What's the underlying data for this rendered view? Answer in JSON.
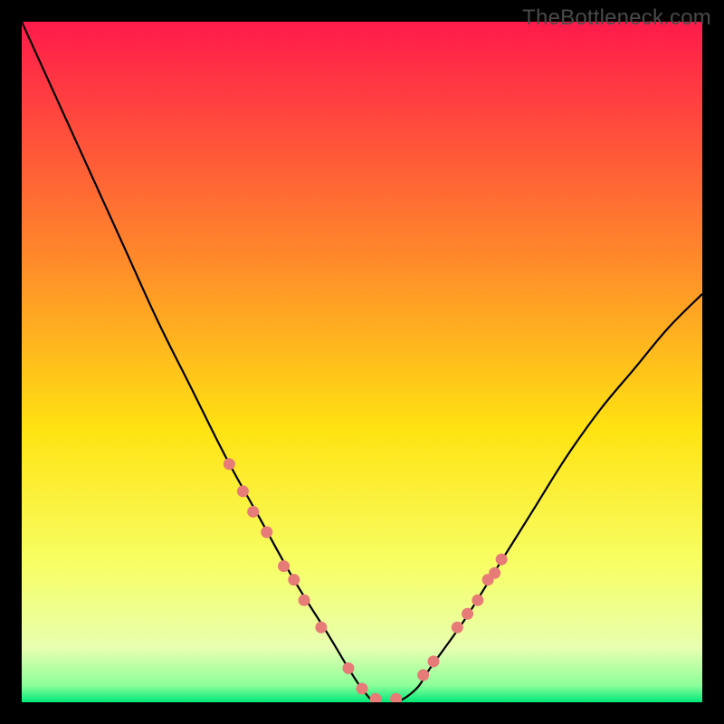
{
  "watermark": "TheBottleneck.com",
  "chart_data": {
    "type": "line",
    "title": "",
    "xlabel": "",
    "ylabel": "",
    "xlim": [
      0,
      100
    ],
    "ylim": [
      0,
      100
    ],
    "background_gradient": {
      "stops": [
        {
          "offset": 0.0,
          "color": "#ff1a4b"
        },
        {
          "offset": 0.35,
          "color": "#ff8a2a"
        },
        {
          "offset": 0.6,
          "color": "#ffe312"
        },
        {
          "offset": 0.8,
          "color": "#f7ff66"
        },
        {
          "offset": 0.92,
          "color": "#e8ffb0"
        },
        {
          "offset": 0.975,
          "color": "#8dff9a"
        },
        {
          "offset": 1.0,
          "color": "#00e87a"
        }
      ]
    },
    "series": [
      {
        "name": "bottleneck-curve",
        "color": "#000000",
        "x": [
          0,
          5,
          10,
          15,
          20,
          25,
          30,
          35,
          40,
          45,
          48,
          50,
          52,
          55,
          58,
          60,
          65,
          70,
          75,
          80,
          85,
          90,
          95,
          100
        ],
        "y": [
          100,
          89,
          78,
          67,
          56,
          46,
          36,
          27,
          18,
          10,
          5,
          2,
          0,
          0,
          2,
          5,
          12,
          20,
          28,
          36,
          43,
          49,
          55,
          60
        ]
      }
    ],
    "markers": {
      "name": "highlighted-points",
      "color": "#e77b78",
      "points": [
        {
          "x": 30.5,
          "y": 35
        },
        {
          "x": 32.5,
          "y": 31
        },
        {
          "x": 34.0,
          "y": 28
        },
        {
          "x": 36.0,
          "y": 25
        },
        {
          "x": 38.5,
          "y": 20
        },
        {
          "x": 40.0,
          "y": 18
        },
        {
          "x": 41.5,
          "y": 15
        },
        {
          "x": 44.0,
          "y": 11
        },
        {
          "x": 48.0,
          "y": 5
        },
        {
          "x": 50.0,
          "y": 2
        },
        {
          "x": 52.0,
          "y": 0.5
        },
        {
          "x": 55.0,
          "y": 0.5
        },
        {
          "x": 59.0,
          "y": 4
        },
        {
          "x": 60.5,
          "y": 6
        },
        {
          "x": 64.0,
          "y": 11
        },
        {
          "x": 65.5,
          "y": 13
        },
        {
          "x": 67.0,
          "y": 15
        },
        {
          "x": 68.5,
          "y": 18
        },
        {
          "x": 69.5,
          "y": 19
        },
        {
          "x": 70.5,
          "y": 21
        }
      ]
    }
  }
}
